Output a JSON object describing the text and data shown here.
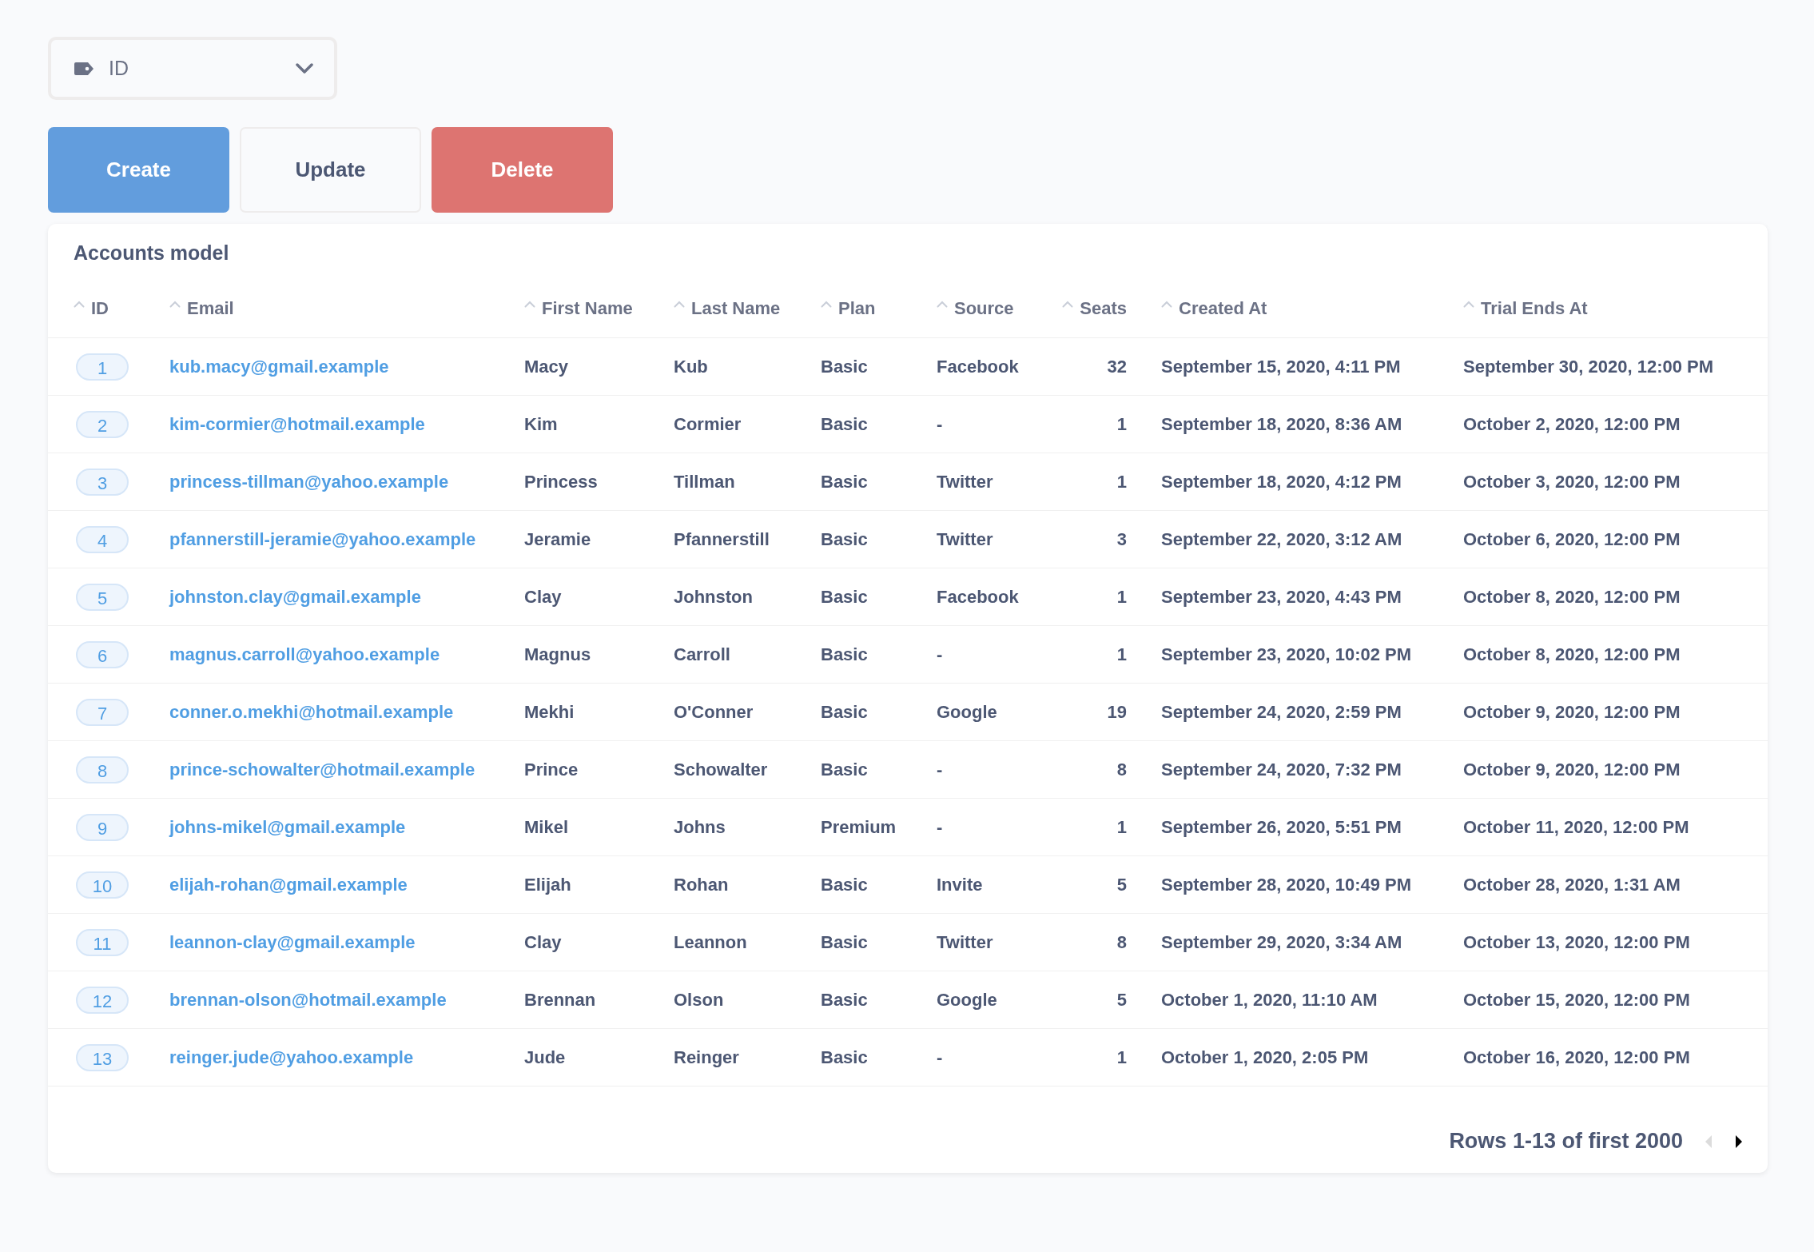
{
  "field_picker": {
    "label": "ID"
  },
  "buttons": [
    {
      "label": "Create",
      "kind": "primary"
    },
    {
      "label": "Update",
      "kind": "default"
    },
    {
      "label": "Delete",
      "kind": "danger"
    }
  ],
  "table": {
    "title": "Accounts model",
    "columns": [
      {
        "label": "ID",
        "kind": "badge"
      },
      {
        "label": "Email",
        "kind": "link"
      },
      {
        "label": "First Name",
        "kind": "text"
      },
      {
        "label": "Last Name",
        "kind": "text"
      },
      {
        "label": "Plan",
        "kind": "text"
      },
      {
        "label": "Source",
        "kind": "text"
      },
      {
        "label": "Seats",
        "kind": "number"
      },
      {
        "label": "Created At",
        "kind": "text"
      },
      {
        "label": "Trial Ends At",
        "kind": "text"
      }
    ],
    "rows": [
      [
        "1",
        "kub.macy@gmail.example",
        "Macy",
        "Kub",
        "Basic",
        "Facebook",
        "32",
        "September 15, 2020, 4:11 PM",
        "September 30, 2020, 12:00 PM"
      ],
      [
        "2",
        "kim-cormier@hotmail.example",
        "Kim",
        "Cormier",
        "Basic",
        "-",
        "1",
        "September 18, 2020, 8:36 AM",
        "October 2, 2020, 12:00 PM"
      ],
      [
        "3",
        "princess-tillman@yahoo.example",
        "Princess",
        "Tillman",
        "Basic",
        "Twitter",
        "1",
        "September 18, 2020, 4:12 PM",
        "October 3, 2020, 12:00 PM"
      ],
      [
        "4",
        "pfannerstill-jeramie@yahoo.example",
        "Jeramie",
        "Pfannerstill",
        "Basic",
        "Twitter",
        "3",
        "September 22, 2020, 3:12 AM",
        "October 6, 2020, 12:00 PM"
      ],
      [
        "5",
        "johnston.clay@gmail.example",
        "Clay",
        "Johnston",
        "Basic",
        "Facebook",
        "1",
        "September 23, 2020, 4:43 PM",
        "October 8, 2020, 12:00 PM"
      ],
      [
        "6",
        "magnus.carroll@yahoo.example",
        "Magnus",
        "Carroll",
        "Basic",
        "-",
        "1",
        "September 23, 2020, 10:02 PM",
        "October 8, 2020, 12:00 PM"
      ],
      [
        "7",
        "conner.o.mekhi@hotmail.example",
        "Mekhi",
        "O'Conner",
        "Basic",
        "Google",
        "19",
        "September 24, 2020, 2:59 PM",
        "October 9, 2020, 12:00 PM"
      ],
      [
        "8",
        "prince-schowalter@hotmail.example",
        "Prince",
        "Schowalter",
        "Basic",
        "-",
        "8",
        "September 24, 2020, 7:32 PM",
        "October 9, 2020, 12:00 PM"
      ],
      [
        "9",
        "johns-mikel@gmail.example",
        "Mikel",
        "Johns",
        "Premium",
        "-",
        "1",
        "September 26, 2020, 5:51 PM",
        "October 11, 2020, 12:00 PM"
      ],
      [
        "10",
        "elijah-rohan@gmail.example",
        "Elijah",
        "Rohan",
        "Basic",
        "Invite",
        "5",
        "September 28, 2020, 10:49 PM",
        "October 28, 2020, 1:31 AM"
      ],
      [
        "11",
        "leannon-clay@gmail.example",
        "Clay",
        "Leannon",
        "Basic",
        "Twitter",
        "8",
        "September 29, 2020, 3:34 AM",
        "October 13, 2020, 12:00 PM"
      ],
      [
        "12",
        "brennan-olson@hotmail.example",
        "Brennan",
        "Olson",
        "Basic",
        "Google",
        "5",
        "October 1, 2020, 11:10 AM",
        "October 15, 2020, 12:00 PM"
      ],
      [
        "13",
        "reinger.jude@yahoo.example",
        "Jude",
        "Reinger",
        "Basic",
        "-",
        "1",
        "October 1, 2020, 2:05 PM",
        "October 16, 2020, 12:00 PM"
      ]
    ]
  },
  "footer": {
    "text": "Rows 1-13 of first 2000",
    "prev": {
      "disabled": true
    },
    "next": {
      "disabled": false
    }
  }
}
